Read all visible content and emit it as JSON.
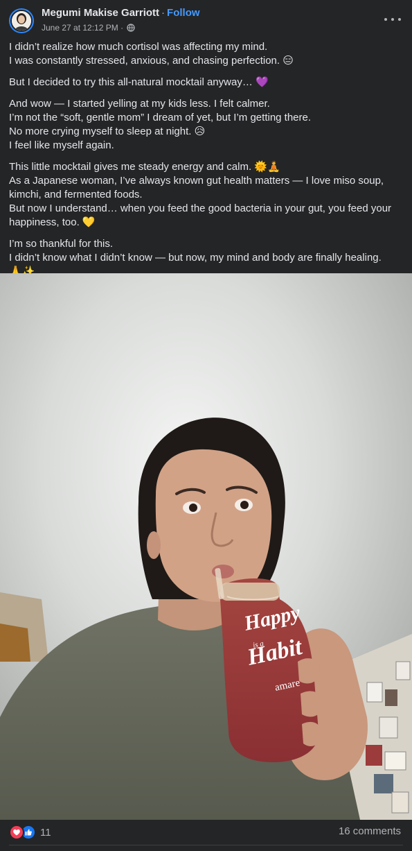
{
  "post": {
    "author": "Megumi Makise Garriott",
    "separator": "·",
    "follow_label": "Follow",
    "timestamp": "June 27 at 12:12 PM",
    "meta_separator": "·",
    "audience_icon": "globe-icon",
    "more_icon": "more-options-icon",
    "paragraphs": [
      [
        "I didn’t realize how much cortisol was affecting my mind.",
        "I was constantly stressed, anxious, and chasing perfection. 😑"
      ],
      [
        "But I decided to try this all-natural mocktail anyway… 💜"
      ],
      [
        "And wow — I started yelling at my kids less. I felt calmer.",
        "I’m not the “soft, gentle mom” I dream of yet, but I’m getting there.",
        "No more crying myself to sleep at night. 😥",
        "I feel like myself again."
      ],
      [
        "This little mocktail gives me steady energy and calm. 🌞🧘",
        "As a Japanese woman, I’ve always known gut health matters — I love miso soup,",
        "kimchi, and fermented foods.",
        "But now I understand… when you feed the good bacteria in your gut, you feed your",
        "happiness, too. 💛"
      ],
      [
        "I’m so thankful for this.",
        "I didn’t know what I didn’t know — but now, my mind and body are finally healing.",
        "🙏✨"
      ]
    ]
  },
  "photo": {
    "cup_text": {
      "line1": "Happy",
      "line2": "is a",
      "line3": "Habit",
      "brand": "amare"
    }
  },
  "footer": {
    "reaction_icons": [
      "love-reaction-icon",
      "like-reaction-icon"
    ],
    "reaction_count": "11",
    "comments_label": "16 comments"
  },
  "colors": {
    "background": "#242526",
    "text": "#e4e6eb",
    "secondary_text": "#b0b3b8",
    "link": "#4599ff",
    "love": "#f33e58",
    "like": "#1877f2"
  }
}
